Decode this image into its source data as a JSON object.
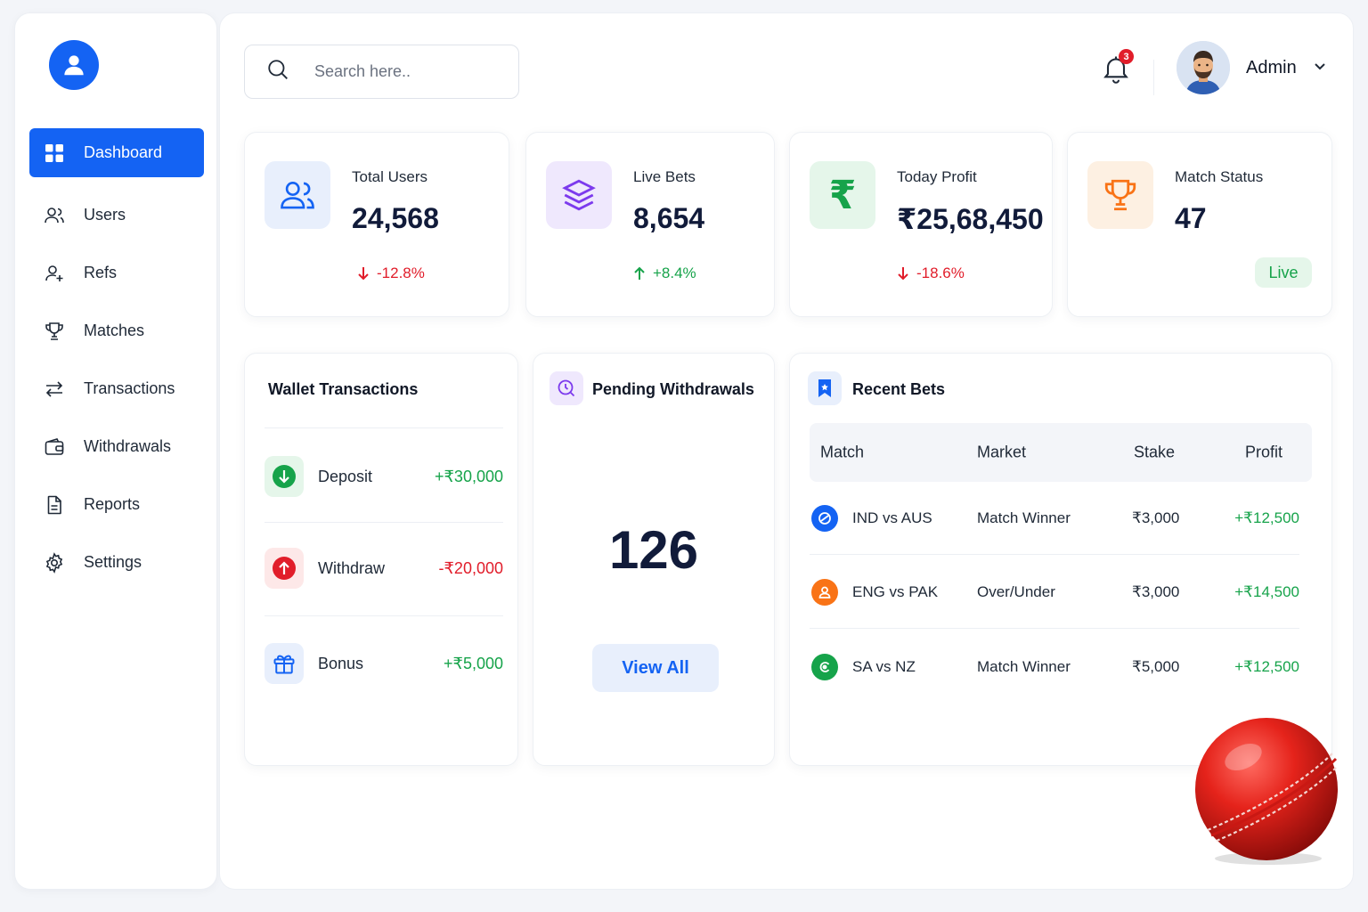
{
  "sidebar": {
    "items": [
      {
        "label": "Dashboard",
        "icon": "dashboard-grid-icon",
        "active": true
      },
      {
        "label": "Users",
        "icon": "users-icon"
      },
      {
        "label": "Refs",
        "icon": "user-plus-icon"
      },
      {
        "label": "Matches",
        "icon": "trophy-icon"
      },
      {
        "label": "Transactions",
        "icon": "arrows-exchange-icon"
      },
      {
        "label": "Withdrawals",
        "icon": "wallet-icon"
      },
      {
        "label": "Reports",
        "icon": "document-icon"
      },
      {
        "label": "Settings",
        "icon": "gear-icon"
      }
    ]
  },
  "header": {
    "search_placeholder": "Search here..",
    "notification_count": "3",
    "user_name": "Admin"
  },
  "stats": [
    {
      "label": "Total Users",
      "value": "24,568",
      "delta": "-12.8%",
      "trend": "down",
      "icon": "users-icon",
      "tile_color": "#e8effc"
    },
    {
      "label": "Live Bets",
      "value": "8,654",
      "delta": "+8.4%",
      "trend": "up",
      "icon": "layers-icon",
      "tile_color": "#efe8fd"
    },
    {
      "label": "Today Profit",
      "value": "₹25,68,450",
      "delta": "-18.6%",
      "trend": "down",
      "icon": "rupee-icon",
      "tile_color": "#e5f6ea"
    },
    {
      "label": "Match Status",
      "value": "47",
      "badge": "Live",
      "icon": "trophy-icon",
      "tile_color": "#fdf0e2"
    }
  ],
  "wallet": {
    "title": "Wallet Transactions",
    "rows": [
      {
        "label": "Deposit",
        "amount": "+₹30,000",
        "type": "credit"
      },
      {
        "label": "Withdraw",
        "amount": "-₹20,000",
        "type": "debit"
      },
      {
        "label": "Bonus",
        "amount": "+₹5,000",
        "type": "credit"
      }
    ]
  },
  "pending": {
    "title": "Pending Withdrawals",
    "value": "126",
    "button": "View All"
  },
  "recent_bets": {
    "title": "Recent Bets",
    "columns": [
      "Match",
      "Market",
      "Stake",
      "Profit"
    ],
    "rows": [
      {
        "match": "IND vs AUS",
        "market": "Match Winner",
        "stake": "₹3,000",
        "profit": "+₹12,500",
        "color": "#1463f3"
      },
      {
        "match": "ENG vs PAK",
        "market": "Over/Under",
        "stake": "₹3,000",
        "profit": "+₹14,500",
        "color": "#f97316"
      },
      {
        "match": "SA vs NZ",
        "market": "Match Winner",
        "stake": "₹5,000",
        "profit": "+₹12,500",
        "color": "#16a34a"
      }
    ]
  },
  "colors": {
    "accent": "#1463f3",
    "positive": "#16a34a",
    "negative": "#e11d2a"
  }
}
